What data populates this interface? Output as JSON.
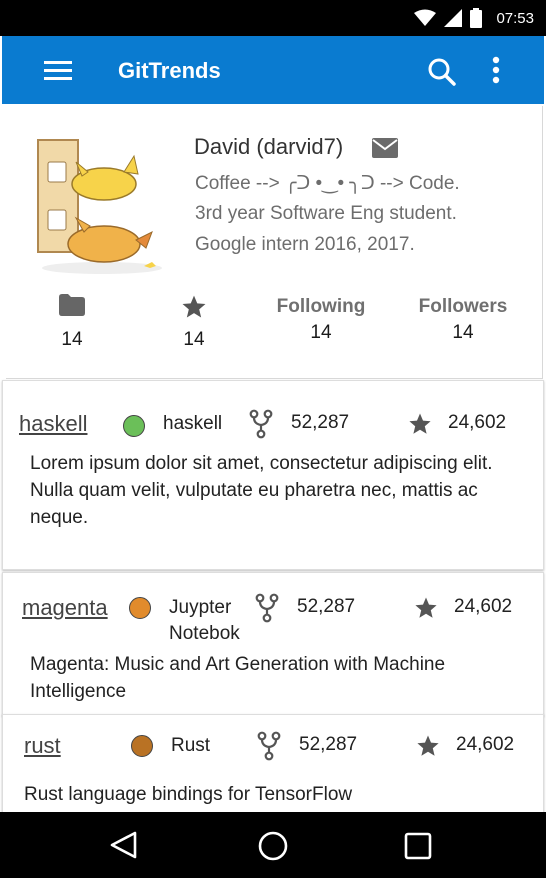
{
  "status_bar": {
    "time": "07:53"
  },
  "app_bar": {
    "title": "GitTrends"
  },
  "profile": {
    "name": "David (darvid7)",
    "bio": [
      "Coffee --> ╭ᑐ •‿• ╮ᑐ --> Code.",
      "3rd year Software Eng student.",
      "Google intern 2016, 2017."
    ],
    "stats": [
      {
        "icon": "folder-icon",
        "value": "14"
      },
      {
        "icon": "star-icon",
        "value": "14"
      },
      {
        "label": "Following",
        "value": "14"
      },
      {
        "label": "Followers",
        "value": "14"
      }
    ]
  },
  "repos": [
    {
      "name": "haskell",
      "language": "haskell",
      "language_color": "#6bbf59",
      "forks": "52,287",
      "stars": "24,602",
      "description": "Lorem ipsum dolor sit amet, consectetur adipiscing elit. Nulla quam velit, vulputate eu pharetra nec, mattis ac neque."
    },
    {
      "name": "magenta",
      "language": "Juypter Notebok",
      "language_color": "#e18b2c",
      "forks": "52,287",
      "stars": "24,602",
      "description": "Magenta: Music and Art Generation with Machine Intelligence"
    },
    {
      "name": "rust",
      "language": "Rust",
      "language_color": "#b97224",
      "forks": "52,287",
      "stars": "24,602",
      "description": "Rust language bindings for TensorFlow"
    }
  ]
}
